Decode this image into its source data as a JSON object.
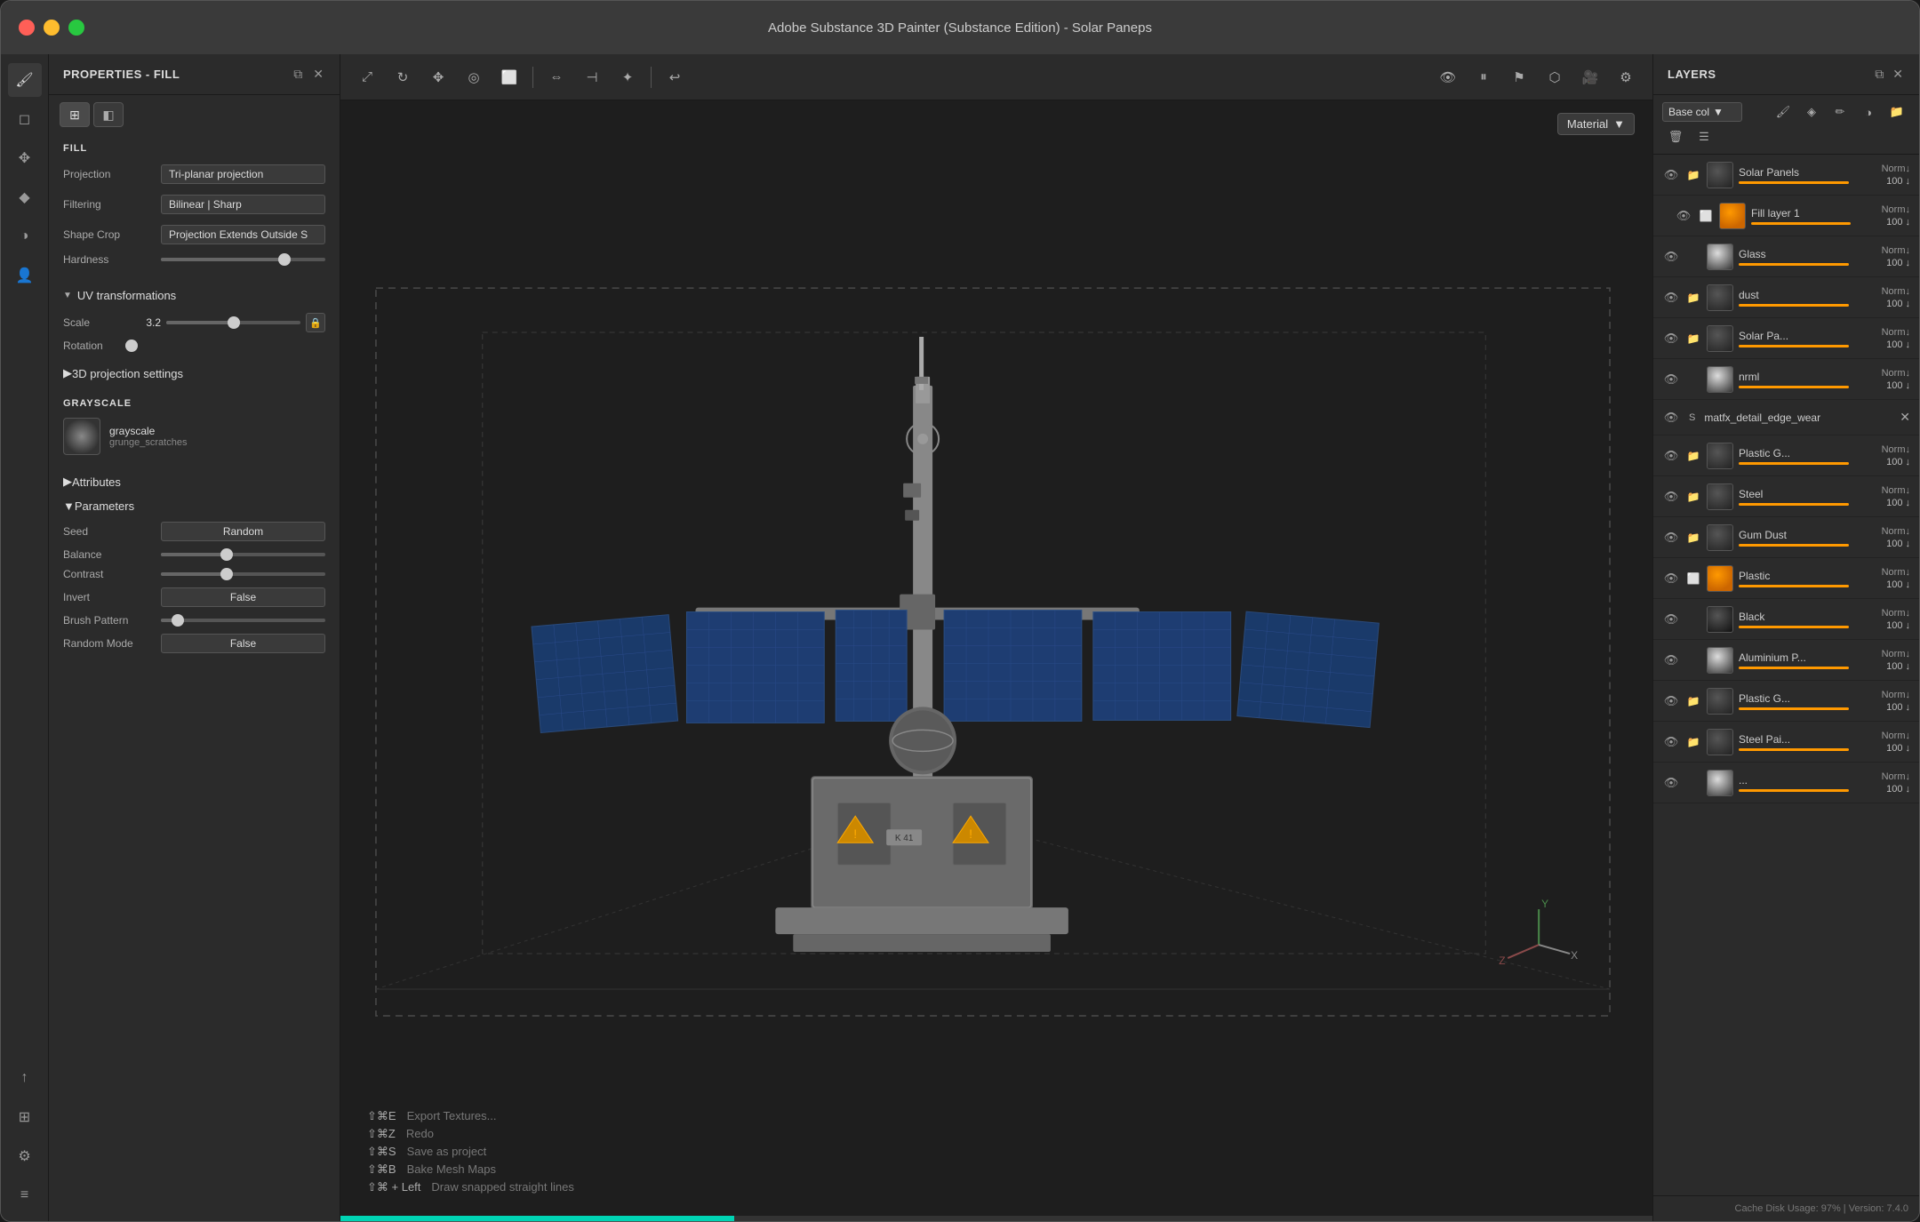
{
  "window": {
    "title": "Adobe Substance 3D Painter (Substance Edition) - Solar Paneps"
  },
  "properties": {
    "title": "PROPERTIES - FILL",
    "tabs": [
      {
        "icon": "⊞",
        "active": true
      },
      {
        "icon": "◧",
        "active": false
      }
    ],
    "fill": {
      "label": "FILL",
      "projection_label": "Projection",
      "projection_value": "Tri-planar projection",
      "filtering_label": "Filtering",
      "filtering_value": "Bilinear | Sharp",
      "shape_crop_label": "Shape Crop",
      "shape_crop_value": "Projection Extends Outside S",
      "hardness_label": "Hardness",
      "hardness_value": 75
    },
    "uv_transformations": {
      "label": "UV transformations",
      "collapsed": false,
      "scale_label": "Scale",
      "scale_value": "3.2",
      "rotation_label": "Rotation",
      "rotation_value": 0
    },
    "projection_3d": {
      "label": "3D projection settings",
      "collapsed": true
    },
    "grayscale": {
      "label": "GRAYSCALE",
      "texture_name": "grayscale",
      "texture_sub": "grunge_scratches"
    },
    "attributes": {
      "label": "Attributes",
      "collapsed": true
    },
    "parameters": {
      "label": "Parameters",
      "collapsed": false,
      "seed_label": "Seed",
      "seed_value": "Random",
      "balance_label": "Balance",
      "contrast_label": "Contrast",
      "invert_label": "Invert",
      "invert_value": "False",
      "brush_pattern_label": "Brush Pattern",
      "random_mode_label": "Random Mode",
      "random_mode_value": "False"
    }
  },
  "viewport": {
    "toolbar_buttons": [
      "↔",
      "⟳",
      "↕",
      "⭮",
      "⬜",
      "⬛",
      "⊞",
      "⇕",
      "✦",
      "🔗"
    ],
    "material_label": "Material",
    "shortcuts": [
      {
        "key": "⇧⌘E",
        "desc": "Export Textures..."
      },
      {
        "key": "⇧⌘Z",
        "desc": "Redo"
      },
      {
        "key": "⇧⌘S",
        "desc": "Save as project"
      },
      {
        "key": "⇧⌘B",
        "desc": "Bake Mesh Maps"
      },
      {
        "key": "⇧⌘ + Left",
        "desc": "Draw snapped straight lines"
      }
    ],
    "progress_value": 30
  },
  "layers": {
    "title": "LAYERS",
    "channel": "Base col",
    "items": [
      {
        "name": "Solar Panels",
        "blend": "Norm",
        "value": 100,
        "type": "folder",
        "visible": true
      },
      {
        "name": "Fill layer 1",
        "blend": "Norm",
        "value": 100,
        "type": "fill",
        "visible": true
      },
      {
        "name": "Glass",
        "blend": "Norm",
        "value": 100,
        "type": "layer",
        "visible": true
      },
      {
        "name": "dust",
        "blend": "Norm",
        "value": 100,
        "type": "folder",
        "visible": true
      },
      {
        "name": "Solar Pa...",
        "blend": "Norm",
        "value": 100,
        "type": "folder",
        "visible": true
      },
      {
        "name": "nrml",
        "blend": "Norm",
        "value": 100,
        "type": "layer",
        "visible": true
      },
      {
        "name": "matfx_detail_edge_wear",
        "blend": "",
        "value": null,
        "type": "special",
        "visible": true
      },
      {
        "name": "Plastic G...",
        "blend": "Norm",
        "value": 100,
        "type": "folder",
        "visible": true
      },
      {
        "name": "Steel",
        "blend": "Norm",
        "value": 100,
        "type": "folder",
        "visible": true
      },
      {
        "name": "Gum Dust",
        "blend": "Norm",
        "value": 100,
        "type": "folder",
        "visible": true
      },
      {
        "name": "Plastic",
        "blend": "Norm",
        "value": 100,
        "type": "fill",
        "visible": true
      },
      {
        "name": "Black",
        "blend": "Norm",
        "value": 100,
        "type": "layer",
        "visible": true
      },
      {
        "name": "Aluminium P...",
        "blend": "Norm",
        "value": 100,
        "type": "layer",
        "visible": true
      },
      {
        "name": "Plastic G...",
        "blend": "Norm",
        "value": 100,
        "type": "folder",
        "visible": true
      },
      {
        "name": "Steel Pai...",
        "blend": "Norm",
        "value": 100,
        "type": "folder",
        "visible": true
      },
      {
        "name": "...",
        "blend": "Norm",
        "value": 100,
        "type": "layer",
        "visible": true
      }
    ],
    "footer": "Cache Disk Usage:   97% | Version: 7.4.0"
  }
}
